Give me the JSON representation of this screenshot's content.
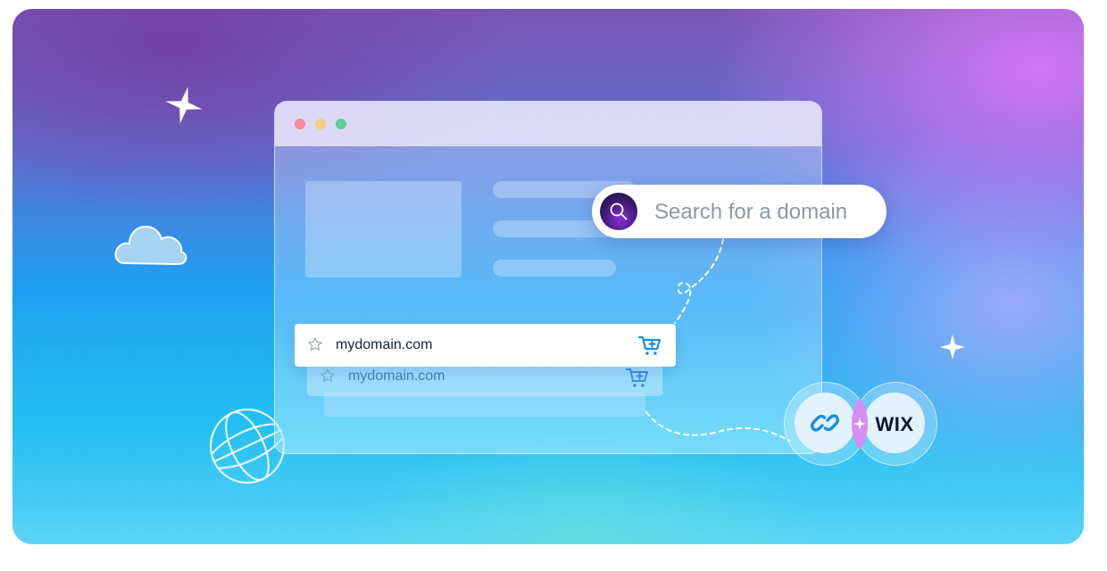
{
  "search": {
    "placeholder_text": "Search for a domain",
    "icon": "magnifier-icon"
  },
  "results": [
    {
      "domain": "mydomain.com",
      "star_icon": "star-outline-icon",
      "cart_icon": "add-to-cart-icon"
    },
    {
      "domain": "mydomain.com",
      "star_icon": "star-outline-icon",
      "cart_icon": "add-to-cart-icon"
    }
  ],
  "browser_window": {
    "controls": [
      "close-dot",
      "minimize-dot",
      "maximize-dot"
    ]
  },
  "integration": {
    "link_icon": "chain-link-icon",
    "brand": "WIX"
  },
  "decorations": [
    "sparkle-icon",
    "cloud-icon",
    "globe-icon"
  ],
  "colors": {
    "accent": "#1c8ee8",
    "search_button": "#3a1a6e",
    "brand_text": "#0b1430"
  }
}
